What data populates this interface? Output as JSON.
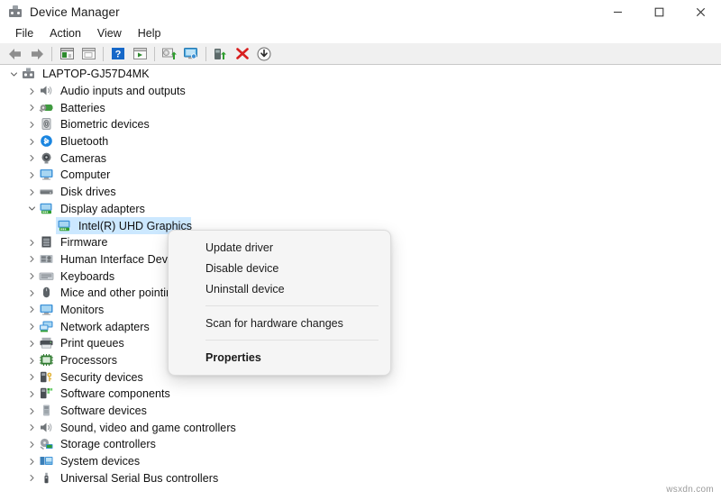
{
  "window": {
    "title": "Device Manager",
    "icon": "device-manager-icon",
    "controls": [
      {
        "name": "minimize-button",
        "glyph": "minimize"
      },
      {
        "name": "maximize-button",
        "glyph": "maximize"
      },
      {
        "name": "close-button",
        "glyph": "close"
      }
    ]
  },
  "menubar": {
    "items": [
      {
        "label": "File"
      },
      {
        "label": "Action"
      },
      {
        "label": "View"
      },
      {
        "label": "Help"
      }
    ]
  },
  "toolbar": {
    "buttons": [
      {
        "name": "back-button",
        "icon": "back-arrow-icon"
      },
      {
        "name": "forward-button",
        "icon": "forward-arrow-icon"
      },
      {
        "name": "separator-1",
        "icon": "separator"
      },
      {
        "name": "properties-button",
        "icon": "properties-icon"
      },
      {
        "name": "show-hidden-devices-button",
        "icon": "window-icon"
      },
      {
        "name": "separator-2",
        "icon": "separator"
      },
      {
        "name": "help-button",
        "icon": "help-question-icon"
      },
      {
        "name": "view-button",
        "icon": "play-window-icon"
      },
      {
        "name": "separator-3",
        "icon": "separator"
      },
      {
        "name": "scan-hardware-changes-button",
        "icon": "scan-gear-icon"
      },
      {
        "name": "device-properties-button",
        "icon": "monitor-icon"
      },
      {
        "name": "separator-4",
        "icon": "separator"
      },
      {
        "name": "enable-device-button",
        "icon": "enable-device-icon"
      },
      {
        "name": "uninstall-device-button",
        "icon": "red-x-icon"
      },
      {
        "name": "update-driver-button",
        "icon": "download-circle-icon"
      }
    ]
  },
  "tree": {
    "nodes": [
      {
        "label": "LAPTOP-GJ57D4MK",
        "indent": 0,
        "state": "expanded",
        "icon": "computer-root-icon"
      },
      {
        "label": "Audio inputs and outputs",
        "indent": 1,
        "state": "collapsed",
        "icon": "speaker-icon"
      },
      {
        "label": "Batteries",
        "indent": 1,
        "state": "collapsed",
        "icon": "battery-icon"
      },
      {
        "label": "Biometric devices",
        "indent": 1,
        "state": "collapsed",
        "icon": "fingerprint-icon"
      },
      {
        "label": "Bluetooth",
        "indent": 1,
        "state": "collapsed",
        "icon": "bluetooth-icon"
      },
      {
        "label": "Cameras",
        "indent": 1,
        "state": "collapsed",
        "icon": "camera-icon"
      },
      {
        "label": "Computer",
        "indent": 1,
        "state": "collapsed",
        "icon": "monitor-icon"
      },
      {
        "label": "Disk drives",
        "indent": 1,
        "state": "collapsed",
        "icon": "disk-drive-icon"
      },
      {
        "label": "Display adapters",
        "indent": 1,
        "state": "expanded",
        "icon": "display-adapter-icon"
      },
      {
        "label": "Intel(R) UHD Graphics",
        "indent": 2,
        "state": "leaf",
        "icon": "display-adapter-icon",
        "selected": true
      },
      {
        "label": "Firmware",
        "indent": 1,
        "state": "collapsed",
        "icon": "firmware-icon"
      },
      {
        "label": "Human Interface Devices",
        "indent": 1,
        "state": "collapsed",
        "icon": "hid-icon"
      },
      {
        "label": "Keyboards",
        "indent": 1,
        "state": "collapsed",
        "icon": "keyboard-icon"
      },
      {
        "label": "Mice and other pointing devices",
        "indent": 1,
        "state": "collapsed",
        "icon": "mouse-icon"
      },
      {
        "label": "Monitors",
        "indent": 1,
        "state": "collapsed",
        "icon": "monitor-icon"
      },
      {
        "label": "Network adapters",
        "indent": 1,
        "state": "collapsed",
        "icon": "network-adapter-icon"
      },
      {
        "label": "Print queues",
        "indent": 1,
        "state": "collapsed",
        "icon": "printer-icon"
      },
      {
        "label": "Processors",
        "indent": 1,
        "state": "collapsed",
        "icon": "processor-icon"
      },
      {
        "label": "Security devices",
        "indent": 1,
        "state": "collapsed",
        "icon": "security-key-icon"
      },
      {
        "label": "Software components",
        "indent": 1,
        "state": "collapsed",
        "icon": "software-component-icon"
      },
      {
        "label": "Software devices",
        "indent": 1,
        "state": "collapsed",
        "icon": "software-device-icon"
      },
      {
        "label": "Sound, video and game controllers",
        "indent": 1,
        "state": "collapsed",
        "icon": "speaker-icon"
      },
      {
        "label": "Storage controllers",
        "indent": 1,
        "state": "collapsed",
        "icon": "storage-controller-icon"
      },
      {
        "label": "System devices",
        "indent": 1,
        "state": "collapsed",
        "icon": "system-device-icon"
      },
      {
        "label": "Universal Serial Bus controllers",
        "indent": 1,
        "state": "collapsed",
        "icon": "usb-icon"
      }
    ]
  },
  "context_menu": {
    "items": [
      {
        "label": "Update driver",
        "type": "item"
      },
      {
        "label": "Disable device",
        "type": "item"
      },
      {
        "label": "Uninstall device",
        "type": "item"
      },
      {
        "type": "separator"
      },
      {
        "label": "Scan for hardware changes",
        "type": "item"
      },
      {
        "type": "separator"
      },
      {
        "label": "Properties",
        "type": "item",
        "bold": true
      }
    ]
  },
  "watermark": {
    "text": "wsxdn.com"
  },
  "colors": {
    "selection": "#cce8ff",
    "toolbar_bg": "#f0f0f0",
    "menu_bg": "#f5f5f5",
    "text": "#101010",
    "accent_blue": "#0078d4",
    "uninstall_red": "#d81f1f"
  }
}
